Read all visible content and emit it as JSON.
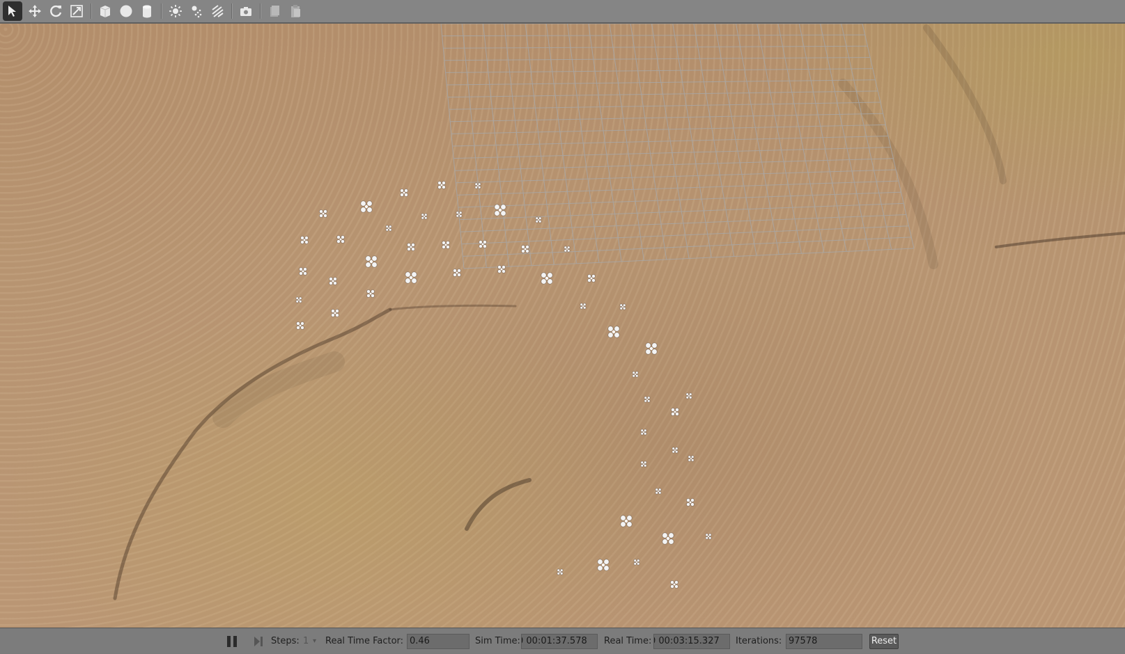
{
  "toolbar": {
    "tools": [
      {
        "name": "select-arrow-icon",
        "active": true
      },
      {
        "name": "translate-icon"
      },
      {
        "name": "rotate-icon"
      },
      {
        "name": "scale-icon"
      },
      {
        "name": "box-icon"
      },
      {
        "name": "sphere-icon"
      },
      {
        "name": "cylinder-icon"
      },
      {
        "name": "point-light-icon"
      },
      {
        "name": "spot-light-icon"
      },
      {
        "name": "directional-light-icon"
      },
      {
        "name": "screenshot-icon"
      },
      {
        "name": "copy-icon"
      },
      {
        "name": "paste-icon"
      }
    ]
  },
  "status": {
    "steps_label": "Steps:",
    "steps_value": "1",
    "rtf_label": "Real Time Factor:",
    "rtf_value": "0.46",
    "sim_time_label": "Sim Time:",
    "sim_time_value": "0 00:01:37.578",
    "real_time_label": "Real Time:",
    "real_time_value": "0 00:03:15.327",
    "iterations_label": "Iterations:",
    "iterations_value": "97578",
    "reset_label": "Reset"
  },
  "colors": {
    "ground": "#b8936f",
    "grid": "#a3a3a3",
    "drone": "#f4f4f4",
    "active_tool": "#2f2f2f"
  }
}
